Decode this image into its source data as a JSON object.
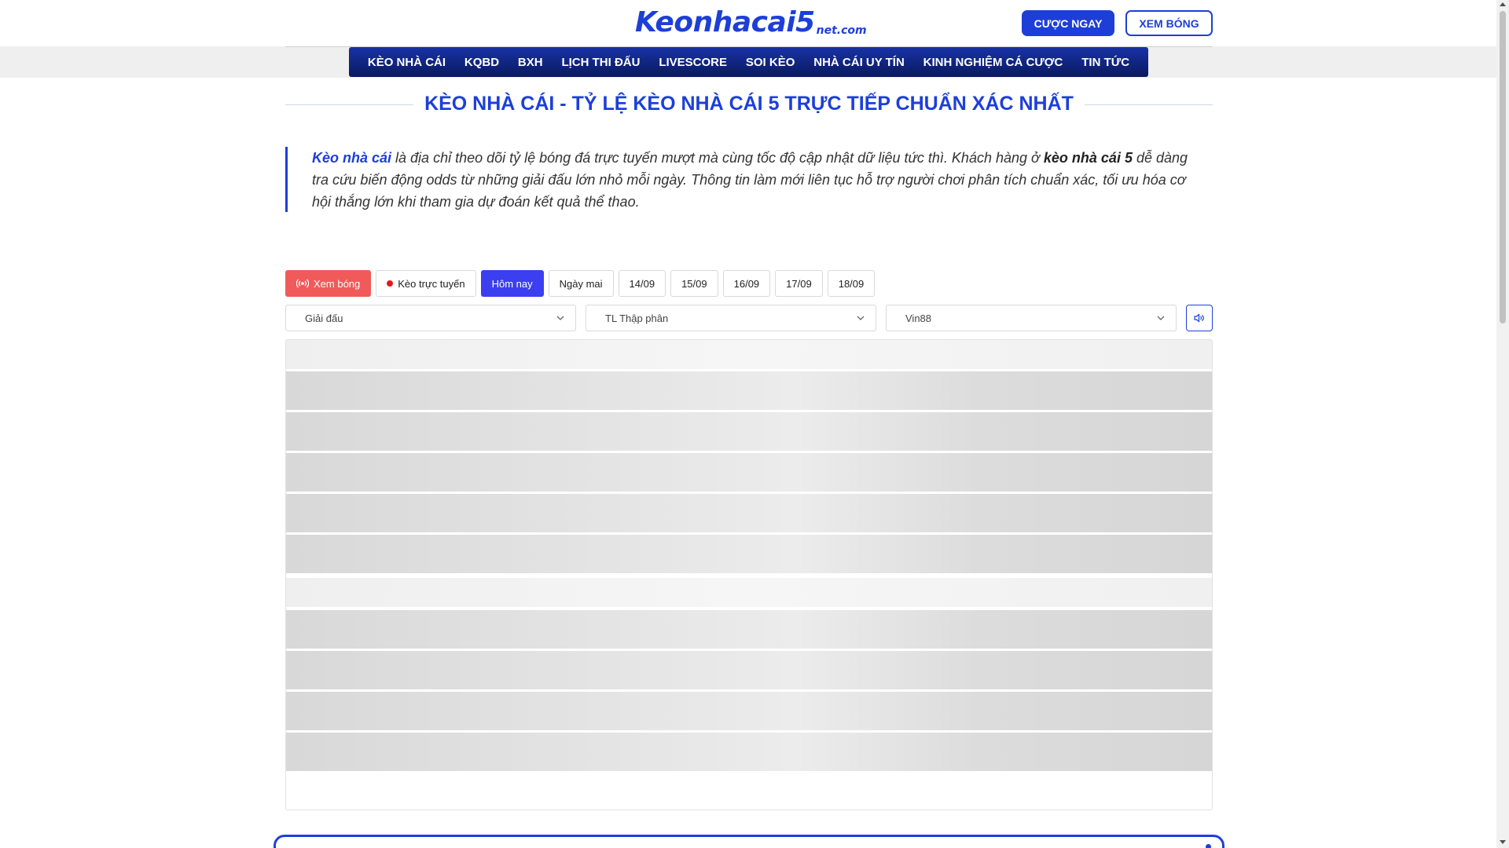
{
  "header": {
    "logo_main": "Keonhacai5",
    "logo_sub": "net.com",
    "bet_button": "CƯỢC NGAY",
    "watch_button": "XEM BÓNG"
  },
  "nav": {
    "items": [
      "KÈO NHÀ CÁI",
      "KQBD",
      "BXH",
      "LỊCH THI ĐẤU",
      "LIVESCORE",
      "SOI KÈO",
      "NHÀ CÁI UY TÍN",
      "KINH NGHIỆM CÁ CƯỢC",
      "TIN TỨC"
    ]
  },
  "page_title": "KÈO NHÀ CÁI - TỶ LỆ KÈO NHÀ CÁI 5 TRỰC TIẾP CHUẨN XÁC NHẤT",
  "intro": {
    "link_text": "Kèo nhà cái",
    "text_1": " là địa chỉ theo dõi tỷ lệ bóng đá trực tuyến mượt mà cùng tốc độ cập nhật dữ liệu tức thì. Khách hàng ở ",
    "strong_text": "kèo nhà cái 5",
    "text_2": " dễ dàng tra cứu biến động odds từ những giải đấu lớn nhỏ mỗi ngày. Thông tin làm mới liên tục hỗ trợ người chơi phân tích chuẩn xác, tối ưu hóa cơ hội thắng lớn khi tham gia dự đoán kết quả thể thao."
  },
  "tabs": {
    "live": "Xem bóng",
    "online": "Kèo trực tuyến",
    "today": "Hôm nay",
    "tomorrow": "Ngày mai",
    "dates": [
      "14/09",
      "15/09",
      "16/09",
      "17/09",
      "18/09"
    ]
  },
  "filters": {
    "league": "Giải đấu",
    "odds_format": "TL Thập phân",
    "bookmaker": "Vin88"
  },
  "colors": {
    "brand_blue": "#1d3fd8",
    "active_tab": "#3b3ff0",
    "live_red": "#f15a5a"
  },
  "icons": {
    "live": "broadcast-icon",
    "online": "red-dot-icon",
    "dropdown": "chevron-down-icon",
    "sound": "speaker-icon"
  }
}
